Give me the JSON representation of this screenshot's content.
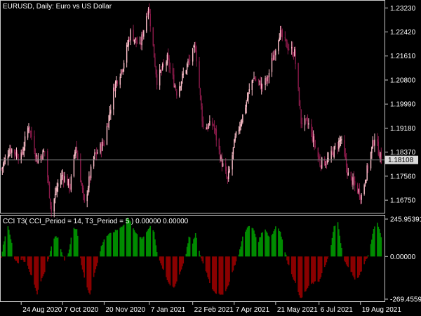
{
  "window": {
    "symbol_title": "EURUSD, Daily:  Euro vs US Dollar",
    "indicator_title": "CCI T3( CCI_Period = 14, T3_Period = 5 ) 0.00000 0.00000"
  },
  "colors": {
    "background": "#000000",
    "bull_candle": "#ffc0cb",
    "bear_candle": "#8b1a4a",
    "positive_hist": "#008c00",
    "negative_hist": "#8b0000",
    "bid_line": "#7f7f7f",
    "grid_frame": "#c8c8c8"
  },
  "price_axis": {
    "ticks": [
      "1.23230",
      "1.22420",
      "1.21610",
      "1.20800",
      "1.19990",
      "1.19180",
      "1.18370",
      "1.17560",
      "1.16750"
    ],
    "current_price": "1.18108"
  },
  "indicator_axis": {
    "ticks": [
      "245.95391",
      "0.00000",
      "-269.45591"
    ]
  },
  "time_axis": {
    "ticks": [
      "24 Aug 2020",
      "7 Oct 2020",
      "20 Nov 2020",
      "7 Jan 2021",
      "22 Feb 2021",
      "7 Apr 2021",
      "21 May 2021",
      "6 Jul 2021",
      "19 Aug 2021"
    ]
  },
  "chart_data": [
    {
      "type": "candlestick",
      "title": "EURUSD, Daily:  Euro vs US Dollar",
      "ylim": [
        1.1635,
        1.2345
      ],
      "x": [
        "24 Aug 2020",
        "7 Oct 2020",
        "20 Nov 2020",
        "7 Jan 2021",
        "22 Feb 2021",
        "7 Apr 2021",
        "21 May 2021",
        "6 Jul 2021",
        "19 Aug 2021"
      ],
      "close_path": [
        [
          "2020-08-03",
          1.178
        ],
        [
          "2020-08-12",
          1.185
        ],
        [
          "2020-08-24",
          1.182
        ],
        [
          "2020-09-01",
          1.193
        ],
        [
          "2020-09-10",
          1.181
        ],
        [
          "2020-09-18",
          1.184
        ],
        [
          "2020-09-25",
          1.164
        ],
        [
          "2020-10-02",
          1.173
        ],
        [
          "2020-10-07",
          1.176
        ],
        [
          "2020-10-15",
          1.172
        ],
        [
          "2020-10-21",
          1.186
        ],
        [
          "2020-10-30",
          1.166
        ],
        [
          "2020-11-09",
          1.182
        ],
        [
          "2020-11-20",
          1.187
        ],
        [
          "2020-12-01",
          1.206
        ],
        [
          "2020-12-10",
          1.213
        ],
        [
          "2020-12-18",
          1.224
        ],
        [
          "2020-12-28",
          1.219
        ],
        [
          "2021-01-06",
          1.233
        ],
        [
          "2021-01-15",
          1.208
        ],
        [
          "2021-01-26",
          1.215
        ],
        [
          "2021-02-05",
          1.204
        ],
        [
          "2021-02-16",
          1.213
        ],
        [
          "2021-02-25",
          1.219
        ],
        [
          "2021-03-05",
          1.192
        ],
        [
          "2021-03-16",
          1.193
        ],
        [
          "2021-03-24",
          1.181
        ],
        [
          "2021-03-31",
          1.174
        ],
        [
          "2021-04-08",
          1.188
        ],
        [
          "2021-04-16",
          1.196
        ],
        [
          "2021-04-27",
          1.209
        ],
        [
          "2021-05-06",
          1.206
        ],
        [
          "2021-05-12",
          1.208
        ],
        [
          "2021-05-25",
          1.224
        ],
        [
          "2021-06-01",
          1.22
        ],
        [
          "2021-06-10",
          1.217
        ],
        [
          "2021-06-17",
          1.194
        ],
        [
          "2021-06-25",
          1.193
        ],
        [
          "2021-07-07",
          1.18
        ],
        [
          "2021-07-16",
          1.181
        ],
        [
          "2021-07-29",
          1.188
        ],
        [
          "2021-08-06",
          1.176
        ],
        [
          "2021-08-12",
          1.173
        ],
        [
          "2021-08-20",
          1.169
        ],
        [
          "2021-08-27",
          1.179
        ],
        [
          "2021-09-03",
          1.189
        ],
        [
          "2021-09-10",
          1.181
        ]
      ]
    },
    {
      "type": "area",
      "title": "CCI T3( CCI_Period = 14, T3_Period = 5 ) 0.00000 0.00000",
      "ylim": [
        -269.45591,
        245.95391
      ],
      "x": [
        "24 Aug 2020",
        "7 Oct 2020",
        "20 Nov 2020",
        "7 Jan 2021",
        "22 Feb 2021",
        "7 Apr 2021",
        "21 May 2021",
        "6 Jul 2021",
        "19 Aug 2021"
      ],
      "series": [
        {
          "values": [
            [
              "2020-08-03",
              0
            ],
            [
              "2020-08-06",
              100
            ],
            [
              "2020-08-10",
              190
            ],
            [
              "2020-08-13",
              110
            ],
            [
              "2020-08-17",
              -20
            ],
            [
              "2020-08-21",
              -40
            ],
            [
              "2020-08-25",
              -10
            ],
            [
              "2020-08-31",
              -60
            ],
            [
              "2020-09-04",
              -120
            ],
            [
              "2020-09-10",
              -230
            ],
            [
              "2020-09-14",
              -150
            ],
            [
              "2020-09-18",
              -90
            ],
            [
              "2020-09-22",
              -10
            ],
            [
              "2020-09-26",
              80
            ],
            [
              "2020-09-30",
              130
            ],
            [
              "2020-10-03",
              100
            ],
            [
              "2020-10-06",
              20
            ],
            [
              "2020-10-10",
              -30
            ],
            [
              "2020-10-14",
              40
            ],
            [
              "2020-10-18",
              180
            ],
            [
              "2020-10-22",
              170
            ],
            [
              "2020-10-27",
              -50
            ],
            [
              "2020-11-01",
              -180
            ],
            [
              "2020-11-05",
              -230
            ],
            [
              "2020-11-09",
              -120
            ],
            [
              "2020-11-13",
              -40
            ],
            [
              "2020-11-17",
              60
            ],
            [
              "2020-11-21",
              120
            ],
            [
              "2020-11-27",
              140
            ],
            [
              "2020-12-03",
              160
            ],
            [
              "2020-12-10",
              190
            ],
            [
              "2020-12-15",
              240
            ],
            [
              "2020-12-19",
              200
            ],
            [
              "2020-12-26",
              120
            ],
            [
              "2020-12-31",
              110
            ],
            [
              "2021-01-04",
              150
            ],
            [
              "2021-01-08",
              190
            ],
            [
              "2021-01-12",
              150
            ],
            [
              "2021-01-15",
              30
            ],
            [
              "2021-01-19",
              -40
            ],
            [
              "2021-01-24",
              -120
            ],
            [
              "2021-01-28",
              -170
            ],
            [
              "2021-02-02",
              -190
            ],
            [
              "2021-02-06",
              -140
            ],
            [
              "2021-02-11",
              -60
            ],
            [
              "2021-02-15",
              20
            ],
            [
              "2021-02-18",
              120
            ],
            [
              "2021-02-22",
              80
            ],
            [
              "2021-02-25",
              140
            ],
            [
              "2021-02-28",
              50
            ],
            [
              "2021-03-04",
              -30
            ],
            [
              "2021-03-09",
              -100
            ],
            [
              "2021-03-13",
              -180
            ],
            [
              "2021-03-18",
              -220
            ],
            [
              "2021-03-24",
              -240
            ],
            [
              "2021-03-30",
              -200
            ],
            [
              "2021-04-03",
              -140
            ],
            [
              "2021-04-07",
              -60
            ],
            [
              "2021-04-12",
              10
            ],
            [
              "2021-04-16",
              120
            ],
            [
              "2021-04-20",
              170
            ],
            [
              "2021-04-24",
              190
            ],
            [
              "2021-04-28",
              160
            ],
            [
              "2021-05-02",
              80
            ],
            [
              "2021-05-06",
              140
            ],
            [
              "2021-05-10",
              170
            ],
            [
              "2021-05-14",
              120
            ],
            [
              "2021-05-18",
              140
            ],
            [
              "2021-05-22",
              200
            ],
            [
              "2021-05-26",
              150
            ],
            [
              "2021-05-30",
              50
            ],
            [
              "2021-06-03",
              -40
            ],
            [
              "2021-06-08",
              -120
            ],
            [
              "2021-06-13",
              -200
            ],
            [
              "2021-06-17",
              -260
            ],
            [
              "2021-06-23",
              -200
            ],
            [
              "2021-06-27",
              -170
            ],
            [
              "2021-07-01",
              -160
            ],
            [
              "2021-07-06",
              -150
            ],
            [
              "2021-07-10",
              -90
            ],
            [
              "2021-07-14",
              -40
            ],
            [
              "2021-07-18",
              40
            ],
            [
              "2021-07-22",
              180
            ],
            [
              "2021-07-26",
              210
            ],
            [
              "2021-07-29",
              80
            ],
            [
              "2021-08-02",
              -30
            ],
            [
              "2021-08-06",
              -60
            ],
            [
              "2021-08-10",
              -100
            ],
            [
              "2021-08-14",
              -160
            ],
            [
              "2021-08-18",
              -110
            ],
            [
              "2021-08-22",
              -60
            ],
            [
              "2021-08-25",
              -20
            ],
            [
              "2021-08-29",
              40
            ],
            [
              "2021-09-02",
              170
            ],
            [
              "2021-09-06",
              210
            ],
            [
              "2021-09-10",
              120
            ],
            [
              "2021-09-12",
              0
            ]
          ]
        }
      ]
    }
  ]
}
